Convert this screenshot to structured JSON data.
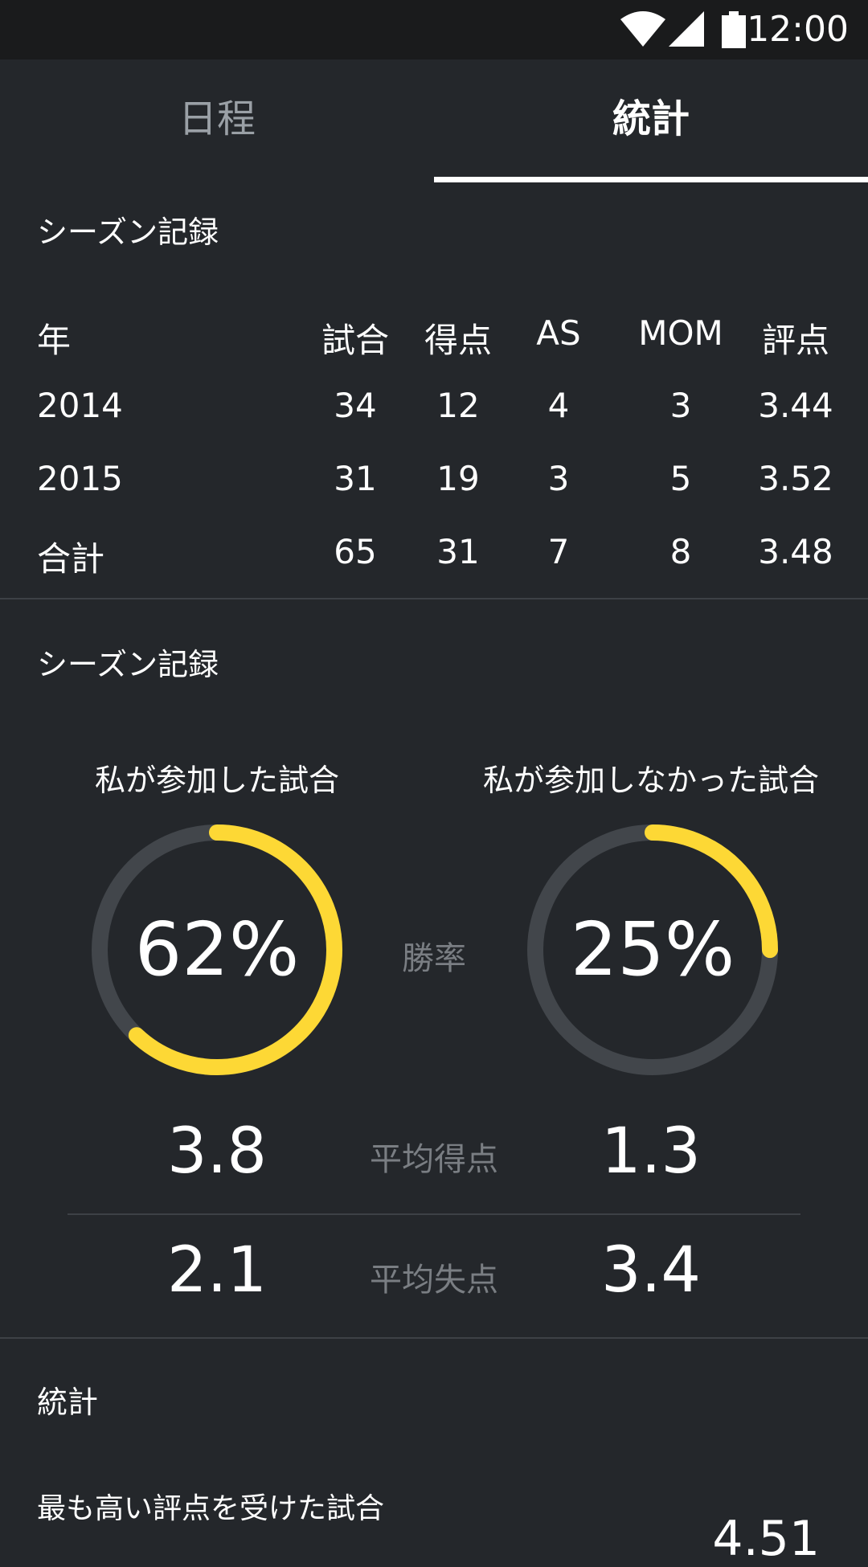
{
  "status_bar": {
    "time": "12:00",
    "icons": [
      "wifi-icon",
      "signal-icon",
      "battery-icon"
    ]
  },
  "tabs": [
    {
      "label": "日程",
      "selected": false
    },
    {
      "label": "統計",
      "selected": true
    }
  ],
  "season_table": {
    "title": "シーズン記録",
    "headers": [
      "年",
      "試合",
      "得点",
      "AS",
      "MOM",
      "評点"
    ],
    "rows": [
      [
        "2014",
        "34",
        "12",
        "4",
        "3",
        "3.44"
      ],
      [
        "2015",
        "31",
        "19",
        "3",
        "5",
        "3.52"
      ],
      [
        "合計",
        "65",
        "31",
        "7",
        "8",
        "3.48"
      ]
    ]
  },
  "season_compare": {
    "title": "シーズン記録",
    "left_label": "私が参加した試合",
    "right_label": "私が参加しなかった試合",
    "win_rate_label": "勝率",
    "left_win_rate": "62%",
    "right_win_rate": "25%",
    "left_win_fraction": 0.62,
    "right_win_fraction": 0.25,
    "avg_scored_label": "平均得点",
    "left_avg_scored": "3.8",
    "right_avg_scored": "1.3",
    "avg_conceded_label": "平均失点",
    "left_avg_conceded": "2.1",
    "right_avg_conceded": "3.4",
    "accent_color": "#fdd835",
    "track_color": "#42464b"
  },
  "stats": {
    "title": "統計",
    "highest_rated_label": "最も高い評点を受けた試合",
    "highest_rated_value": "4.51"
  }
}
